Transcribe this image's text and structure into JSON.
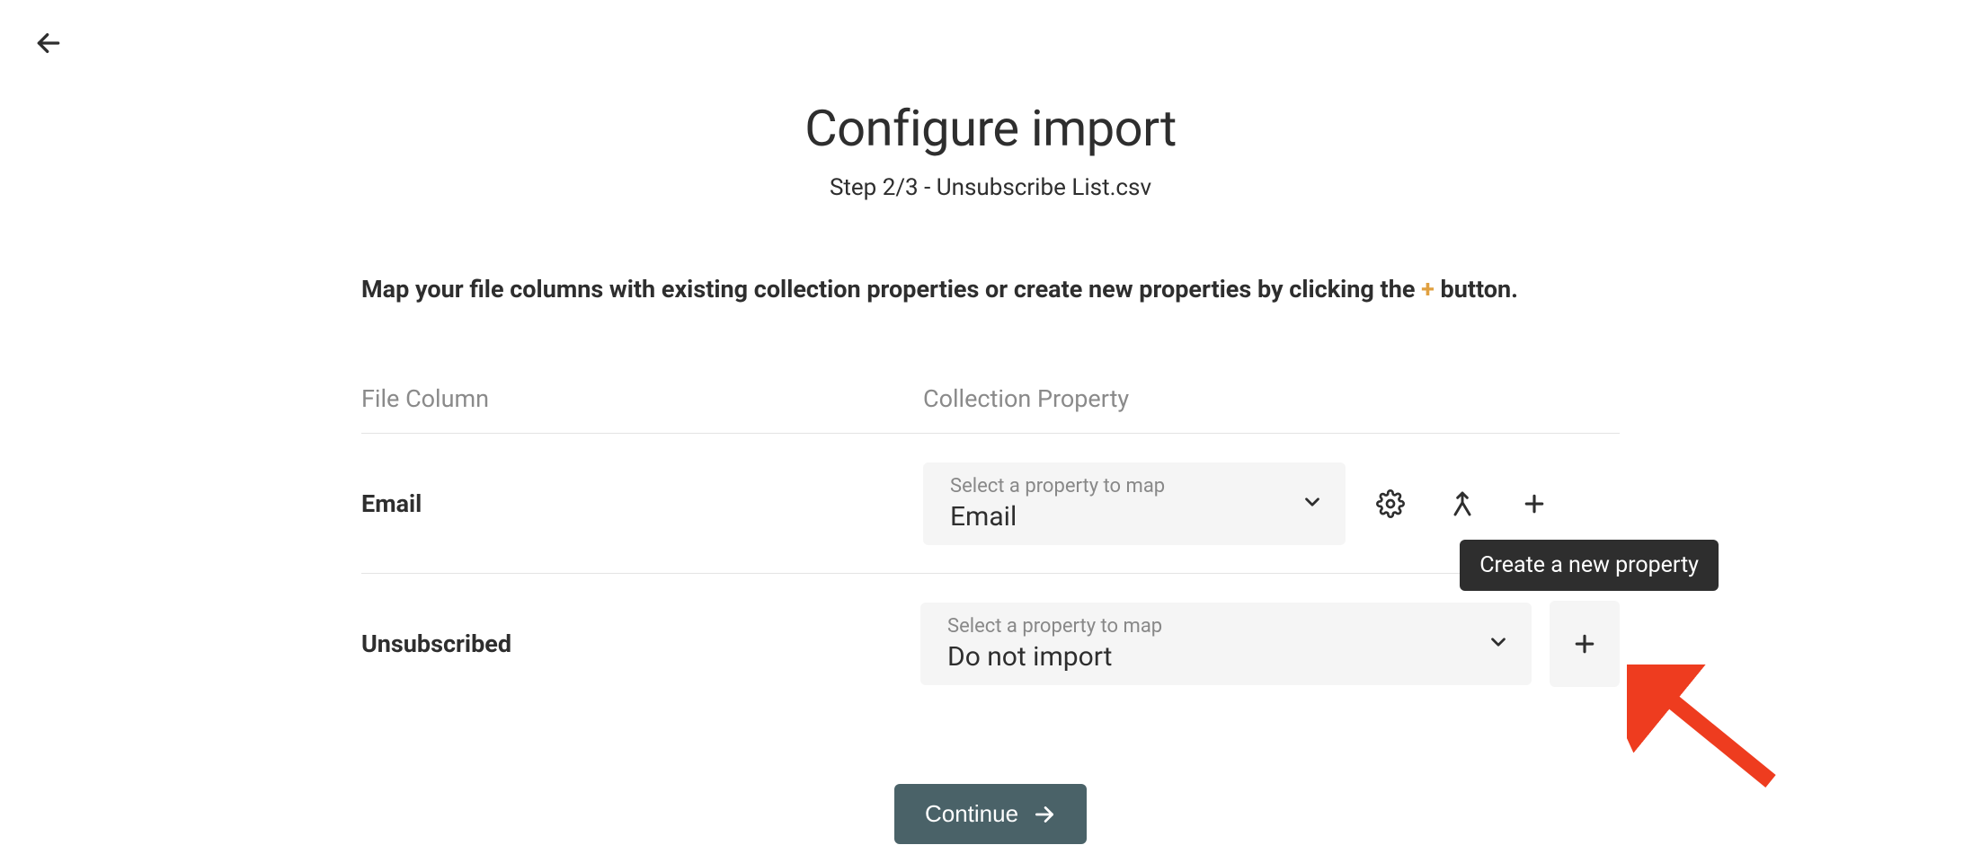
{
  "header": {
    "title": "Configure import",
    "step": "Step 2/3 - Unsubscribe List.csv"
  },
  "instructions": {
    "prefix": "Map your file columns with existing collection properties or create new properties by clicking the ",
    "plus": "+",
    "suffix": " button."
  },
  "table": {
    "headers": {
      "file_column": "File Column",
      "collection_property": "Collection Property"
    },
    "select_placeholder": "Select a property to map",
    "rows": [
      {
        "file_column": "Email",
        "selected_property": "Email"
      },
      {
        "file_column": "Unsubscribed",
        "selected_property": "Do not import"
      }
    ]
  },
  "tooltip": {
    "create_property": "Create a new property"
  },
  "buttons": {
    "continue": "Continue"
  },
  "icons": {
    "back": "arrow-left-icon",
    "gear": "gear-icon",
    "merge": "merge-icon",
    "plus": "plus-icon",
    "chevron": "chevron-down-icon",
    "arrow_right": "arrow-right-icon"
  },
  "colors": {
    "accent_plus": "#e0a040",
    "button_bg": "#4a6268",
    "tooltip_bg": "#2e2e2e",
    "annotation": "#ee3c1f"
  }
}
